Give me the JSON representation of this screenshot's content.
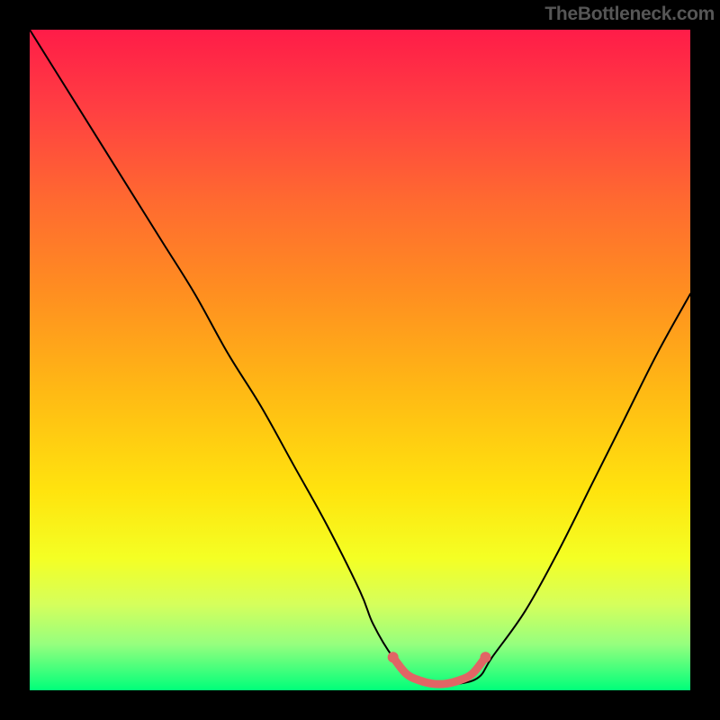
{
  "attribution": "TheBottleneck.com",
  "chart_data": {
    "type": "line",
    "title": "",
    "xlabel": "",
    "ylabel": "",
    "xlim": [
      0,
      100
    ],
    "ylim": [
      0,
      100
    ],
    "grid": false,
    "legend": false,
    "series": [
      {
        "name": "bottleneck-curve",
        "color": "#000000",
        "x": [
          0,
          5,
          10,
          15,
          20,
          25,
          30,
          35,
          40,
          45,
          50,
          52,
          55,
          58,
          60,
          62,
          65,
          68,
          70,
          75,
          80,
          85,
          90,
          95,
          100
        ],
        "y": [
          100,
          92,
          84,
          76,
          68,
          60,
          51,
          43,
          34,
          25,
          15,
          10,
          5,
          2,
          1,
          1,
          1,
          2,
          5,
          12,
          21,
          31,
          41,
          51,
          60
        ]
      },
      {
        "name": "optimal-segment",
        "color": "#e16565",
        "x": [
          55,
          57,
          59,
          61,
          63,
          65,
          67,
          69
        ],
        "y": [
          5,
          2.5,
          1.5,
          1,
          1,
          1.5,
          2.5,
          5
        ]
      }
    ],
    "background_gradient": {
      "stops": [
        {
          "pos": 0.0,
          "color": "#ff1c48"
        },
        {
          "pos": 0.12,
          "color": "#ff3f42"
        },
        {
          "pos": 0.26,
          "color": "#ff6a30"
        },
        {
          "pos": 0.4,
          "color": "#ff8f20"
        },
        {
          "pos": 0.55,
          "color": "#ffba14"
        },
        {
          "pos": 0.7,
          "color": "#ffe40e"
        },
        {
          "pos": 0.8,
          "color": "#f4ff24"
        },
        {
          "pos": 0.87,
          "color": "#d5ff5c"
        },
        {
          "pos": 0.93,
          "color": "#96ff7e"
        },
        {
          "pos": 1.0,
          "color": "#00ff7a"
        }
      ]
    }
  }
}
